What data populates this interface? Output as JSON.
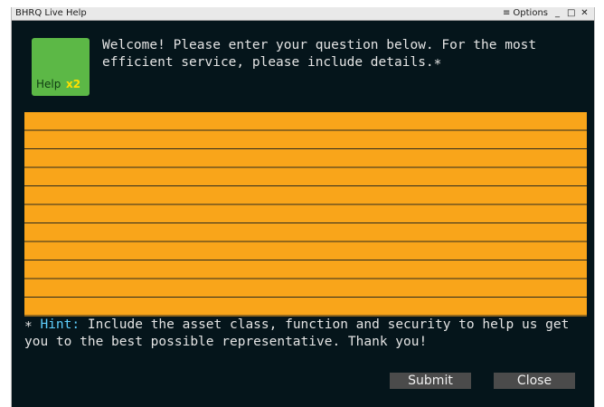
{
  "window": {
    "title": "BHRQ Live Help",
    "options_icon": "hamburger-menu-icon",
    "options_label": "Options",
    "minimize_glyph": "_",
    "maximize_glyph": "□",
    "close_glyph": "✕"
  },
  "logo": {
    "text": "Help",
    "badge": "x2",
    "color": "#5cb846"
  },
  "welcome": {
    "text": "Welcome! Please enter your question below. For the most efficient service, please include details.",
    "marker": "∗"
  },
  "question_input": {
    "value": "",
    "color": "#f9a51a"
  },
  "hint": {
    "marker": "∗",
    "label": "Hint:",
    "text": " Include the asset class, function and security to help us get you to the best possible representative. Thank you!",
    "label_color": "#5fd0ff"
  },
  "buttons": {
    "submit_label": "Submit",
    "close_label": "Close"
  }
}
